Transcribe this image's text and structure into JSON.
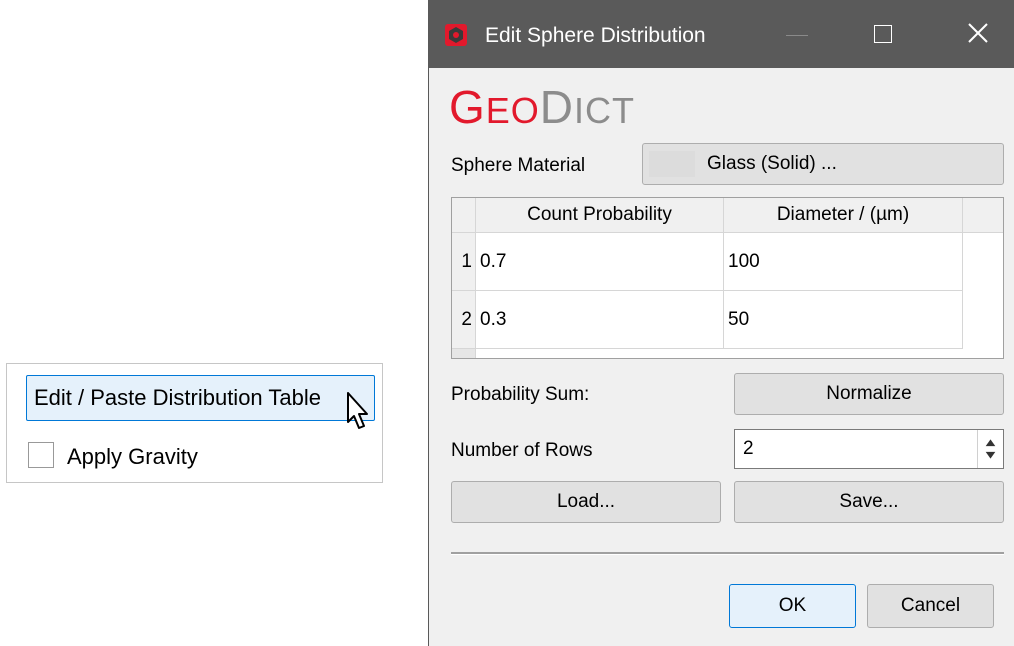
{
  "left_panel": {
    "edit_button_label": "Edit / Paste Distribution Table",
    "gravity_label": "Apply Gravity",
    "gravity_checked": false
  },
  "dialog": {
    "title": "Edit Sphere Distribution",
    "logo_g": "G",
    "logo_eo": "EO",
    "logo_d": "D",
    "logo_ict": "ICT",
    "sphere_material_label": "Sphere Material",
    "material_button": "Glass (Solid) ...",
    "table": {
      "headers": [
        "Count Probability",
        "Diameter / (µm)"
      ],
      "rows": [
        {
          "num": "1",
          "count": "0.7",
          "diameter": "100"
        },
        {
          "num": "2",
          "count": "0.3",
          "diameter": "50"
        }
      ]
    },
    "probability_sum_label": "Probability Sum:",
    "normalize_button": "Normalize",
    "number_of_rows_label": "Number of Rows",
    "number_of_rows_value": "2",
    "load_button": "Load...",
    "save_button": "Save...",
    "ok_button": "OK",
    "cancel_button": "Cancel"
  },
  "colors": {
    "logo_red": "#e2192c",
    "logo_gray": "#8c8c8c",
    "titlebar": "#5a5a5a",
    "accent": "#0078d7"
  },
  "icons": [
    "app-icon",
    "maximize-icon",
    "close-icon",
    "mouse-pointer-icon",
    "spin-up-icon",
    "spin-down-icon"
  ]
}
